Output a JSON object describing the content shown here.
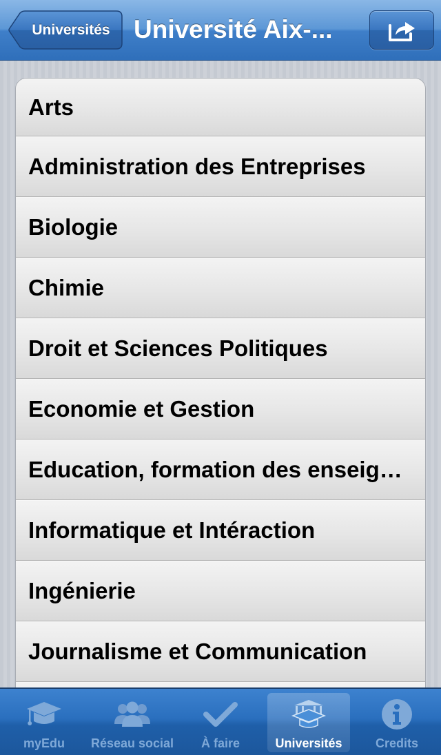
{
  "navbar": {
    "back_label": "Universités",
    "title": "Université Aix-...",
    "share_icon": "share-icon"
  },
  "list": {
    "items": [
      "Arts",
      "Administration des Entreprises",
      "Biologie",
      "Chimie",
      "Droit et Sciences Politiques",
      "Economie et Gestion",
      "Education, formation des enseignants",
      "Informatique et Intéraction",
      "Ingénierie",
      "Journalisme et Communication"
    ]
  },
  "tabbar": {
    "tabs": [
      {
        "label": "myEdu",
        "icon": "graduation-cap-icon",
        "active": false
      },
      {
        "label": "Réseau social",
        "icon": "people-icon",
        "active": false
      },
      {
        "label": "À faire",
        "icon": "checkmark-icon",
        "active": false
      },
      {
        "label": "Universités",
        "icon": "university-icon",
        "active": true
      },
      {
        "label": "Credits",
        "icon": "info-icon",
        "active": false
      }
    ]
  },
  "colors": {
    "nav_blue": "#3f7fc9",
    "tab_active_label": "#ffffff",
    "tab_inactive_label": "#7fa9d8"
  }
}
